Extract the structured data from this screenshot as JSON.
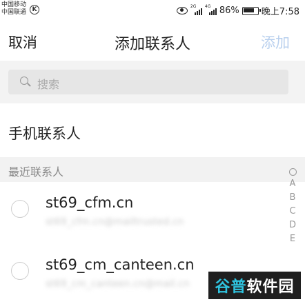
{
  "status_bar": {
    "carrier_1": "中国移动",
    "carrier_2": "中国联通",
    "sig1_tag": "2G",
    "sig2_tag": "4G",
    "battery_text": "86%",
    "battery_level": 0.86,
    "time": "晚上7:58"
  },
  "nav": {
    "cancel": "取消",
    "title": "添加联系人",
    "add": "添加"
  },
  "search": {
    "placeholder": "搜索"
  },
  "sections": {
    "phone_contacts": "手机联系人",
    "recent": "最近联系人"
  },
  "index": [
    "A",
    "B",
    "C",
    "D",
    "E"
  ],
  "contacts": [
    {
      "name": "st69_cfm.cn",
      "sub": "st69_cfm.cn@mailtrusted.cn"
    },
    {
      "name": "st69_cm_canteen.cn",
      "sub": "st69_cm_canteen.cn@mail.cn"
    }
  ],
  "watermark": {
    "accent": "谷普",
    "rest": "软件园"
  }
}
